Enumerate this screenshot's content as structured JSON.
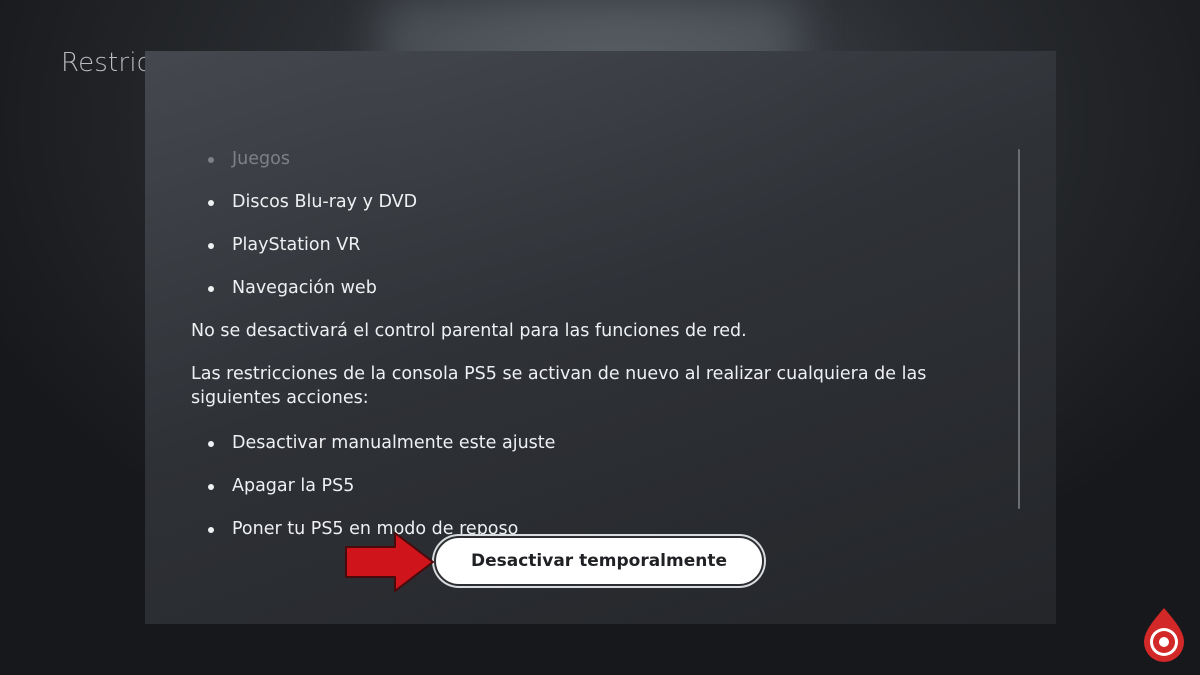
{
  "background": {
    "title": "Restric"
  },
  "dialog": {
    "list_top": [
      {
        "label": "Juegos",
        "faded": true
      },
      {
        "label": "Discos Blu-ray y DVD"
      },
      {
        "label": "PlayStation VR"
      },
      {
        "label": "Navegación web"
      }
    ],
    "paragraph_1": "No se desactivará el control parental para las funciones de red.",
    "paragraph_2": "Las restricciones de la consola PS5 se activan de nuevo al realizar cualquiera de las siguientes acciones:",
    "list_bottom": [
      {
        "label": "Desactivar manualmente este ajuste"
      },
      {
        "label": "Apagar la PS5"
      },
      {
        "label": "Poner tu PS5 en modo de reposo"
      }
    ],
    "button_label": "Desactivar temporalmente"
  },
  "overlay": {
    "arrow_color": "#d0141b",
    "logo_color": "#d22828"
  }
}
